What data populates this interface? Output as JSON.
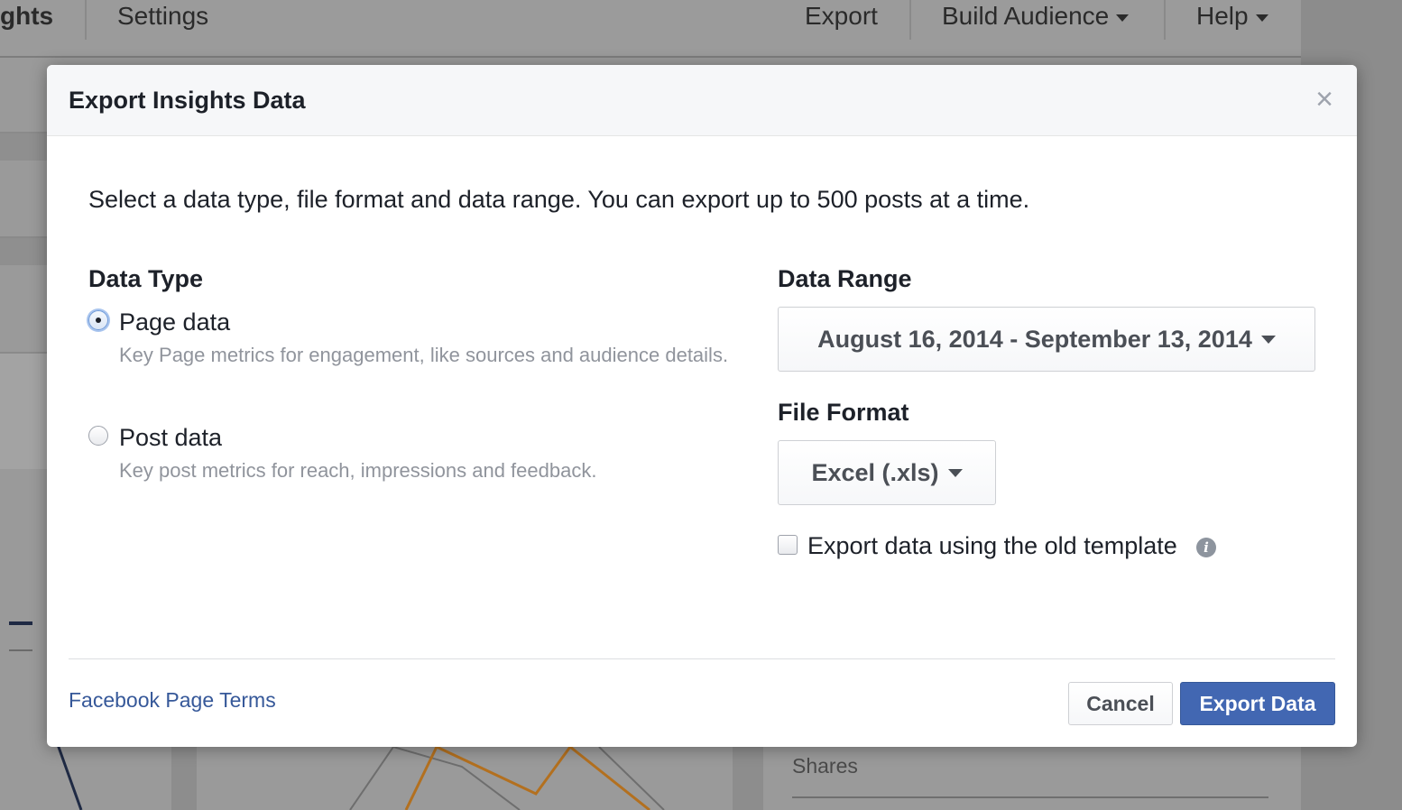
{
  "background": {
    "tabs": {
      "insights": "ghts",
      "settings": "Settings"
    },
    "menu": {
      "export": "Export",
      "build_audience": "Build Audience",
      "help": "Help"
    },
    "shares_label": "Shares"
  },
  "dialog": {
    "title": "Export Insights Data",
    "close_icon": "close-icon",
    "intro": "Select a data type, file format and data range. You can export up to 500 posts at a time.",
    "data_type": {
      "heading": "Data Type",
      "options": [
        {
          "label": "Page data",
          "description": "Key Page metrics for engagement, like sources and audience details.",
          "selected": true
        },
        {
          "label": "Post data",
          "description": "Key post metrics for reach, impressions and feedback.",
          "selected": false
        }
      ]
    },
    "data_range": {
      "heading": "Data Range",
      "value": "August 16, 2014 - September 13, 2014"
    },
    "file_format": {
      "heading": "File Format",
      "value": "Excel (.xls)"
    },
    "old_template": {
      "label": "Export data using the old template",
      "checked": false,
      "info_icon": "info-icon"
    },
    "footer": {
      "terms_link": "Facebook Page Terms",
      "cancel": "Cancel",
      "export": "Export Data"
    }
  },
  "colors": {
    "primary_button": "#4267b2",
    "link": "#365899",
    "overlay": "#9a9a9a"
  }
}
